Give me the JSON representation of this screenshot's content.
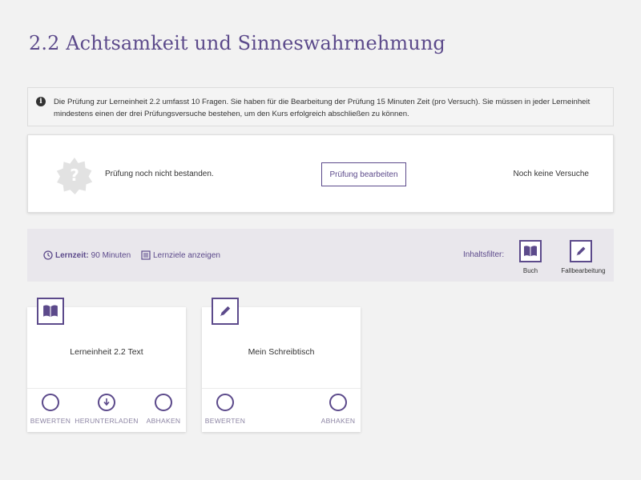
{
  "page": {
    "title": "2.2 Achtsamkeit und Sinneswahrnehmung"
  },
  "info": {
    "icon": "info-icon",
    "text": "Die Prüfung zur Lerneinheit 2.2 umfasst 10 Fragen. Sie haben für die Bearbeitung der Prüfung 15 Minuten Zeit (pro Versuch). Sie müssen in jeder Lerneinheit mindestens einen der drei Prüfungsversuche bestehen, um den Kurs erfolgreich abschließen zu können."
  },
  "exam": {
    "badge_icon": "question-badge-icon",
    "status": "Prüfung noch nicht bestanden.",
    "button_label": "Prüfung bearbeiten",
    "attempts": "Noch keine Versuche"
  },
  "filterbar": {
    "lernzeit_label": "Lernzeit:",
    "lernzeit_value": "90 Minuten",
    "lernziele_label": "Lernziele anzeigen",
    "filter_label": "Inhaltsfilter:",
    "filters": [
      {
        "label": "Buch",
        "icon": "book-icon"
      },
      {
        "label": "Fallbearbeitung",
        "icon": "pencil-icon"
      }
    ]
  },
  "cards": [
    {
      "title": "Lerneinheit 2.2 Text",
      "icon": "book-icon",
      "actions": [
        "BEWERTEN",
        "HERUNTERLADEN",
        "ABHAKEN"
      ]
    },
    {
      "title": "Mein Schreibtisch",
      "icon": "pencil-icon",
      "actions": [
        "BEWERTEN",
        "ABHAKEN"
      ]
    }
  ],
  "colors": {
    "accent": "#5c4a8b",
    "muted": "#8c84a3",
    "background": "#f2f2f2"
  }
}
